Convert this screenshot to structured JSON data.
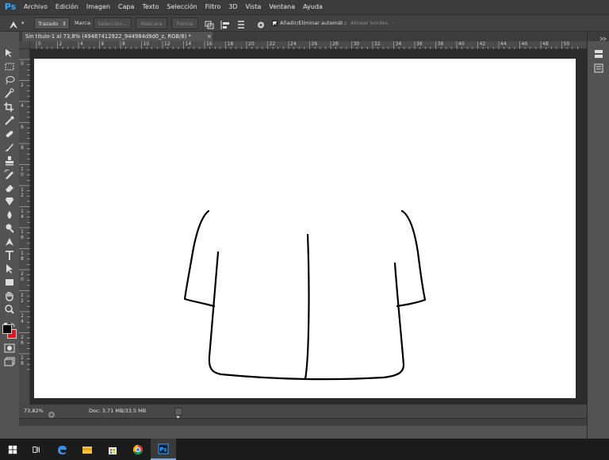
{
  "app": {
    "logo": "Ps"
  },
  "menu": {
    "items": [
      "Archivo",
      "Edición",
      "Imagen",
      "Capa",
      "Texto",
      "Selección",
      "Filtro",
      "3D",
      "Vista",
      "Ventana",
      "Ayuda"
    ]
  },
  "options": {
    "tool_icon": "pen-icon",
    "mode_value": "Trazado",
    "make_label": "Marca:",
    "selection_button": "Selección...",
    "mask_button": "Máscara",
    "shape_button": "Forma",
    "auto_add_delete_label": "Añadir/Eliminar automát.",
    "auto_add_delete_checked": true,
    "align_edges_label": "Alinear bordes",
    "align_edges_checked": false
  },
  "document": {
    "tab_title": "Sin título-1 al 73,8% (49487412922_944984d9d0_z, RGB/8) *",
    "close_glyph": "×"
  },
  "rulers": {
    "top_labels": [
      "0",
      "2",
      "4",
      "6",
      "8",
      "10",
      "12",
      "14",
      "16",
      "18",
      "20",
      "22",
      "24",
      "26",
      "28",
      "30",
      "32",
      "34",
      "36",
      "38",
      "40",
      "42",
      "44",
      "46",
      "48",
      "50"
    ],
    "left_labels": [
      "0",
      "2",
      "4",
      "6",
      "8",
      "10",
      "12",
      "14",
      "16",
      "18",
      "20",
      "22",
      "24",
      "26",
      "28"
    ]
  },
  "status": {
    "zoom": "73,82%",
    "doc": "Doc: 3,71 MB/33,5 MB"
  },
  "toolbar": {
    "tools": [
      "move-tool-icon",
      "marquee-tool-icon",
      "lasso-tool-icon",
      "quick-select-tool-icon",
      "crop-tool-icon",
      "eyedropper-tool-icon",
      "healing-brush-tool-icon",
      "brush-tool-icon",
      "stamp-tool-icon",
      "history-brush-tool-icon",
      "eraser-tool-icon",
      "gradient-tool-icon",
      "blur-tool-icon",
      "dodge-tool-icon",
      "pen-tool-icon",
      "type-tool-icon",
      "path-select-tool-icon",
      "rectangle-tool-icon",
      "hand-tool-icon",
      "zoom-tool-icon"
    ],
    "foreground_color": "#000000",
    "background_color": "#e8141b"
  },
  "taskbar": {
    "items": [
      "windows-start-icon",
      "task-view-icon",
      "edge-browser-icon",
      "file-explorer-icon",
      "store-icon",
      "chrome-icon",
      "photoshop-icon"
    ],
    "active": "photoshop-icon"
  },
  "colors": {
    "ps_accent": "#31a8ff",
    "canvas": "#ffffff",
    "workspace": "#2b2b2b"
  }
}
